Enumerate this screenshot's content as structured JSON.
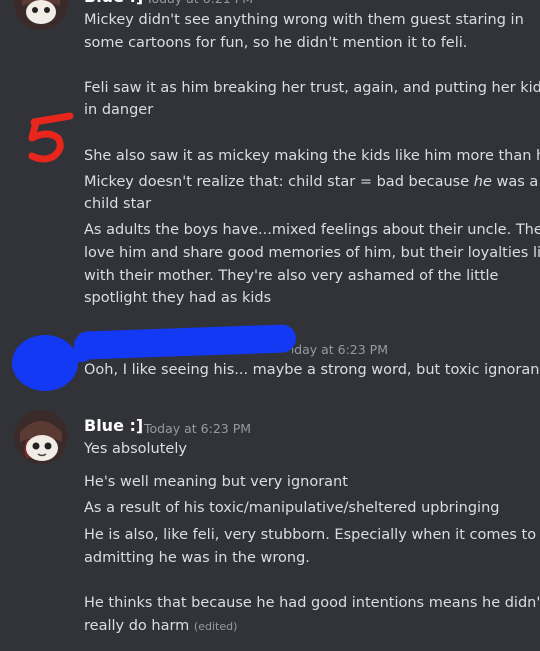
{
  "messages": {
    "first": {
      "username": "Blue :]",
      "timestamp": "Today at 6:21 PM",
      "lines": [
        "Mickey didn't see anything wrong with them guest staring in",
        "some cartoons for fun, so he didn't mention it to feli.",
        "Feli saw it as him breaking her trust, again, and putting her kids",
        "in danger",
        "She also saw it as mickey making the kids like him more than her",
        "child star",
        "As adults the boys have...mixed feelings about their uncle. They",
        "love him and share good memories of him, but their loyalties lie",
        "with their mother. They're also very ashamed of the little",
        "spotlight they had as kids"
      ],
      "italic_line": {
        "before": "Mickey doesn't realize that: child star = bad because ",
        "italic": "he",
        "after": " was a"
      }
    },
    "second": {
      "timestamp": "Today at 6:23 PM",
      "text": "Ooh, I like seeing his... maybe a strong word, but toxic ignorance"
    },
    "third": {
      "username": "Blue :]",
      "timestamp": "Today at 6:23 PM",
      "lines": [
        "Yes absolutely",
        "He's well meaning but very ignorant",
        "As a result of his toxic/manipulative/sheltered upbringing",
        "He is also, like feli, very stubborn. Especially when it comes to",
        "admitting he was in the wrong.",
        "He thinks that because he had good intentions means he didn't",
        "really do harm"
      ],
      "edited_tag": "(edited)"
    }
  },
  "annotation": {
    "number": "5",
    "color": "#e8261c"
  },
  "colors": {
    "background": "#313338",
    "text": "#dbdee1",
    "muted": "#949ba4",
    "redaction": "#1339f5"
  }
}
